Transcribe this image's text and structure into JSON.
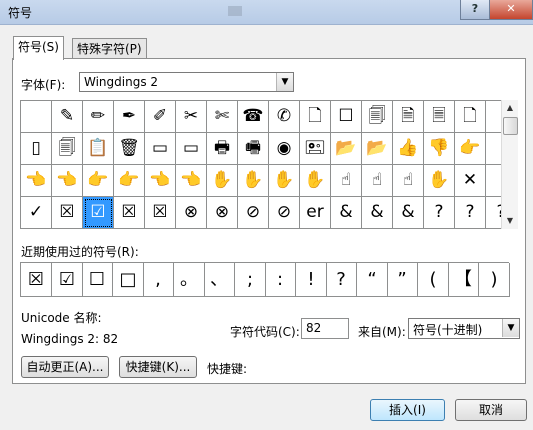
{
  "window": {
    "title": "符号",
    "help": "?",
    "close": "✕"
  },
  "tabs": [
    {
      "label": "符号(S)"
    },
    {
      "label": "特殊字符(P)"
    }
  ],
  "font": {
    "label": "字体(F):",
    "value": "Wingdings 2"
  },
  "symbol_grid": [
    [
      "",
      "✎",
      "✏",
      "✒",
      "✐",
      "✂",
      "✄",
      "☎",
      "✆",
      "🗋",
      "☐",
      "🗐",
      "🗎",
      "🗏",
      "🗋"
    ],
    [
      "▯",
      "🗐",
      "📋",
      "🗑",
      "▭",
      "▭",
      "🖶",
      "🖷",
      "◉",
      "🖭",
      "📂",
      "📂",
      "👍",
      "👎",
      "👉"
    ],
    [
      "👈",
      "👈",
      "👉",
      "👉",
      "👈",
      "👈",
      "✋",
      "✋",
      "✋",
      "✋",
      "☝",
      "☝",
      "☝",
      "✋",
      "✕"
    ],
    [
      "✓",
      "☒",
      "☑",
      "☒",
      "☒",
      "⊗",
      "⊗",
      "⊘",
      "⊘",
      "er",
      "&",
      "&",
      "&",
      "?",
      "?",
      "?"
    ]
  ],
  "recent": {
    "label": "近期使用过的符号(R):",
    "items": [
      "☒",
      "☑",
      "☐",
      "□",
      ",",
      "。",
      "、",
      ";",
      ":",
      "!",
      "?",
      "“",
      "”",
      "(",
      "【",
      ")"
    ]
  },
  "unicode_name_label": "Unicode 名称:",
  "char_name": "Wingdings 2: 82",
  "code_label": "字符代码(C):",
  "code_value": "82",
  "from_label": "来自(M):",
  "from_value": "符号(十进制)",
  "buttons": {
    "autocorrect": "自动更正(A)...",
    "shortcut": "快捷键(K)...",
    "shortcut_label": "快捷键:",
    "insert": "插入(I)",
    "cancel": "取消"
  }
}
